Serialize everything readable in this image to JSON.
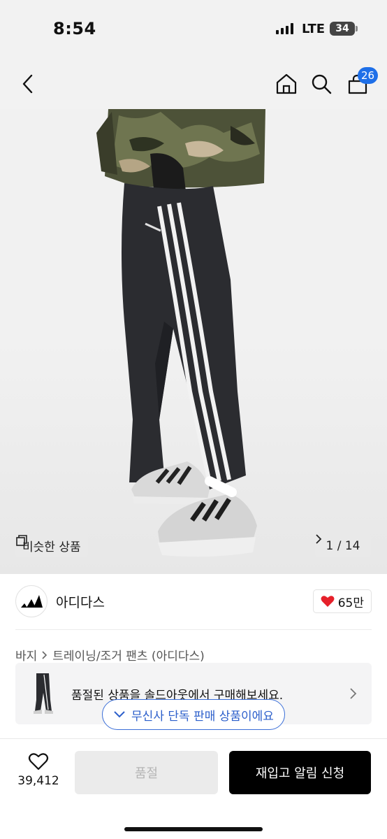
{
  "status_bar": {
    "time": "8:54",
    "network": "LTE",
    "battery": "34"
  },
  "header": {
    "back_icon": "chevron-left-icon",
    "home_icon": "home-icon",
    "search_icon": "search-icon",
    "cart_icon": "cart-icon",
    "cart_count": "26",
    "accent_color": "#1e6fe8"
  },
  "gallery": {
    "similar_label": "비슷한 상품",
    "current_page": "1",
    "total_pages": "14",
    "page_text": "1 / 14"
  },
  "brand": {
    "name": "아디다스",
    "likes": "65만",
    "heart_color": "#e6202a"
  },
  "breadcrumb": {
    "items": [
      "바지",
      "트레이닝/조거 팬츠 (아디다스)"
    ]
  },
  "soldout_banner": {
    "text": "품절된 상품을 솔드아웃에서 구매해보세요."
  },
  "exclusive_badge": {
    "text": "무신사 단독 판매 상품이에요",
    "color": "#3b6fd8"
  },
  "bottom_bar": {
    "wishlist_count": "39,412",
    "soldout_label": "품절",
    "restock_label": "재입고 알림 신청"
  }
}
